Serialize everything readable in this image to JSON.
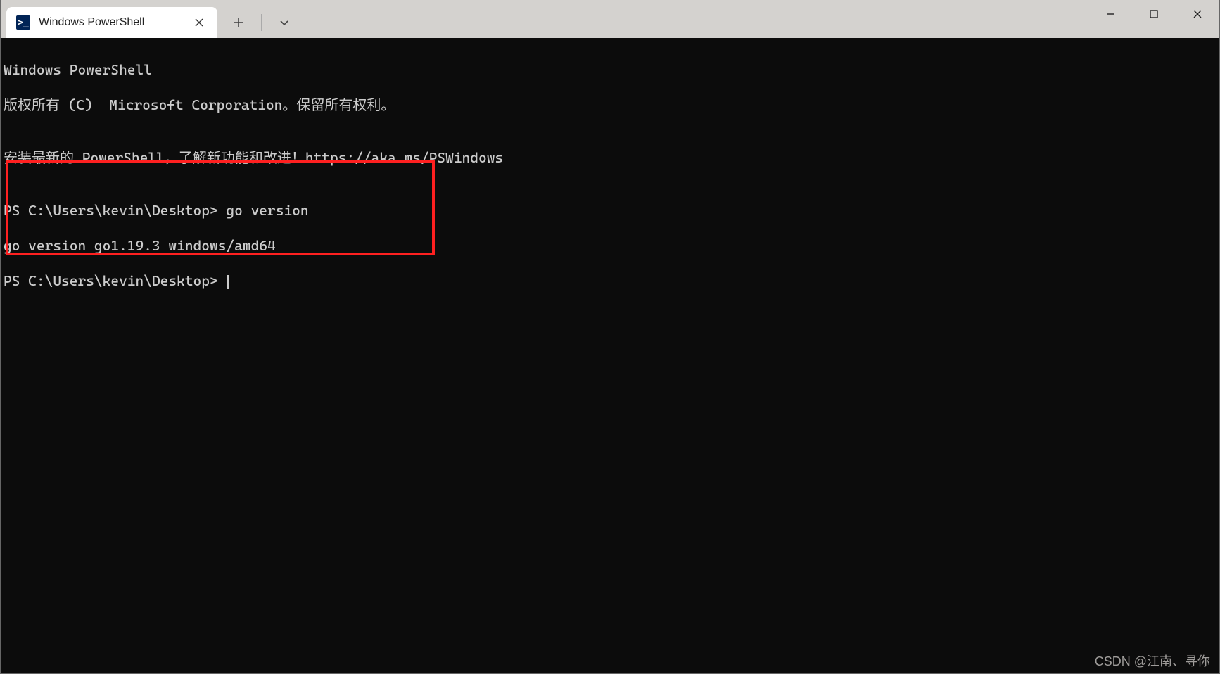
{
  "titlebar": {
    "tab": {
      "title": "Windows PowerShell",
      "icon_label": ">_"
    },
    "new_tab_label": "+",
    "dropdown_label": "⌄",
    "controls": {
      "minimize": "—",
      "maximize": "☐",
      "close": "✕"
    }
  },
  "terminal": {
    "line1": "Windows PowerShell",
    "line2": "版权所有 (C)  Microsoft Corporation。保留所有权利。",
    "line3": "",
    "line4": "安装最新的 PowerShell，了解新功能和改进！https://aka.ms/PSWindows",
    "line5": "",
    "prompt1_prefix": "PS C:\\Users\\kevin\\Desktop> ",
    "prompt1_cmd": "go version",
    "output1": "go version go1.19.3 windows/amd64",
    "prompt2_prefix": "PS C:\\Users\\kevin\\Desktop> "
  },
  "watermark": "CSDN @江南、寻你"
}
